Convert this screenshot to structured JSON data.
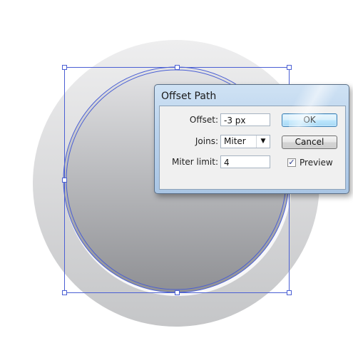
{
  "dialog": {
    "title": "Offset Path",
    "offset": {
      "label": "Offset:",
      "value": "-3 px"
    },
    "joins": {
      "label": "Joins:",
      "value": "Miter"
    },
    "miter_limit": {
      "label": "Miter limit:",
      "value": "4"
    },
    "ok_label": "OK",
    "cancel_label": "Cancel",
    "preview": {
      "label": "Preview",
      "checked": true
    }
  },
  "icons": {
    "dropdown": "chevron-down-icon",
    "check": "checkmark-icon"
  },
  "colors": {
    "selection": "#4a5fd4",
    "dialog_frame": "#b9d2ec",
    "default_button": "#a7d9f5"
  }
}
